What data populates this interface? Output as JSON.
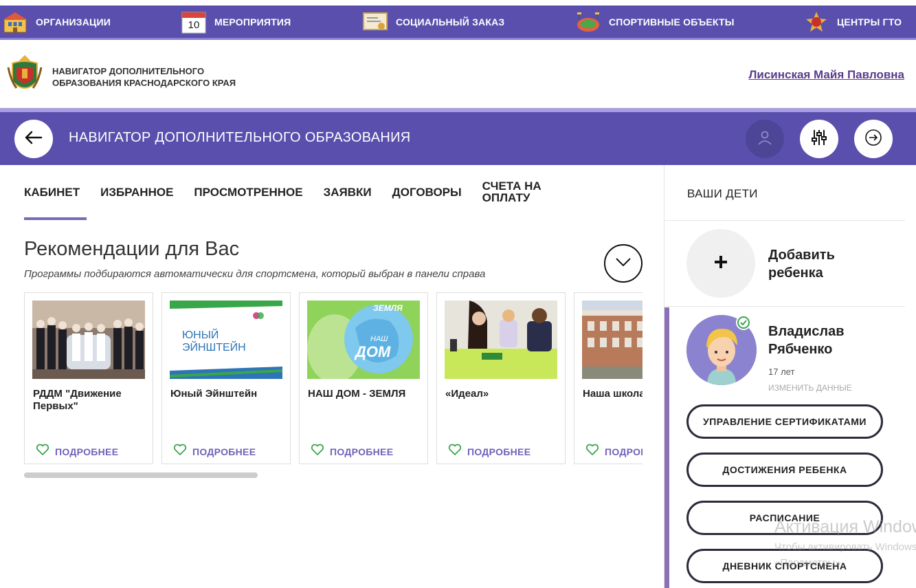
{
  "topnav": {
    "items": [
      {
        "label": "ОРГАНИЗАЦИИ",
        "icon": "building-icon"
      },
      {
        "label": "МЕРОПРИЯТИЯ",
        "icon": "calendar-icon",
        "calendar_day": "10"
      },
      {
        "label": "СОЦИАЛЬНЫЙ ЗАКАЗ",
        "icon": "certificate-icon"
      },
      {
        "label": "СПОРТИВНЫЕ ОБЪЕКТЫ",
        "icon": "stadium-icon"
      },
      {
        "label": "ЦЕНТРЫ ГТО",
        "icon": "gto-badge-icon"
      }
    ]
  },
  "header": {
    "brand_text": "НАВИГАТОР ДОПОЛНИТЕЛЬНОГО ОБРАЗОВАНИЯ КРАСНОДАРСКОГО КРАЯ",
    "user_name": "Лисинская Майя Павловна"
  },
  "titlebar": {
    "title": "НАВИГАТОР ДОПОЛНИТЕЛЬНОГО ОБРАЗОВАНИЯ"
  },
  "tabs": [
    {
      "label": "КАБИНЕТ",
      "active": true
    },
    {
      "label": "ИЗБРАННОЕ"
    },
    {
      "label": "ПРОСМОТРЕННОЕ"
    },
    {
      "label": "ЗАЯВКИ"
    },
    {
      "label": "ДОГОВОРЫ"
    },
    {
      "label": "СЧЕТА НА ОПЛАТУ"
    }
  ],
  "recommendations": {
    "title": "Рекомендации для Вас",
    "subtitle": "Программы подбираются автоматически для спортсмена, который выбран в панели справа",
    "more_label": "ПОДРОБНЕЕ",
    "cards": [
      {
        "title": "РДДМ \"Движение Первых\""
      },
      {
        "title": "Юный Эйнштейн",
        "image_text": "ЮНЫЙ ЭЙНШТЕЙН"
      },
      {
        "title": "НАШ ДОМ - ЗЕМЛЯ",
        "image_text_top": "ЗЕМЛЯ",
        "image_text_small": "НАШ",
        "image_text_big": "ДОМ"
      },
      {
        "title": "«Идеал»"
      },
      {
        "title": "Наша школа"
      }
    ]
  },
  "children_panel": {
    "title": "ВАШИ ДЕТИ",
    "add_label": "Добавить ребенка",
    "child": {
      "name": "Владислав Рябченко",
      "age": "17 лет",
      "edit_label": "ИЗМЕНИТЬ ДАННЫЕ"
    },
    "buttons": {
      "certificates": "УПРАВЛЕНИЕ СЕРТИФИКАТАМИ",
      "achievements": "ДОСТИЖЕНИЯ РЕБЕНКА",
      "schedule": "РАСПИСАНИЕ",
      "diary": "ДНЕВНИК СПОРТСМЕНА"
    }
  },
  "watermark": {
    "line1": "Активация Windows",
    "line2": "Чтобы активировать Windows,",
    "line3": "«Параметры»."
  },
  "colors": {
    "primary": "#5b4fae",
    "accent": "#7b6bb4",
    "link": "#5b3a8c",
    "like": "#3aa64a"
  }
}
